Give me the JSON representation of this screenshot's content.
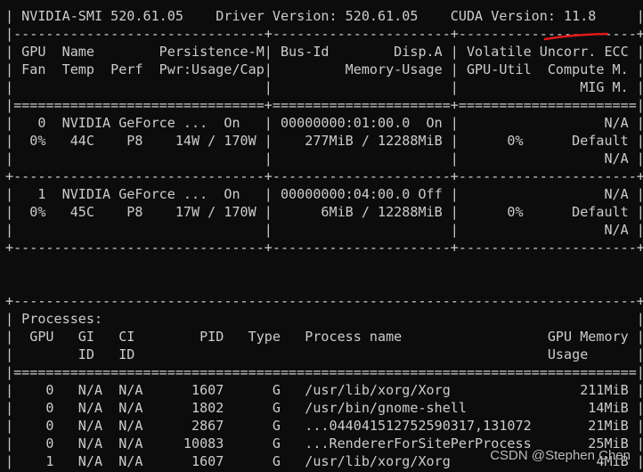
{
  "terminal": {
    "lines": [
      "| NVIDIA-SMI 520.61.05    Driver Version: 520.61.05    CUDA Version: 11.8     |",
      "|-------------------------------+----------------------+----------------------+",
      "| GPU  Name        Persistence-M| Bus-Id        Disp.A | Volatile Uncorr. ECC |",
      "| Fan  Temp  Perf  Pwr:Usage/Cap|         Memory-Usage | GPU-Util  Compute M. |",
      "|                               |                      |               MIG M. |",
      "|===============================+======================+======================|",
      "|   0  NVIDIA GeForce ...  On   | 00000000:01:00.0  On |                  N/A |",
      "|  0%   44C    P8    14W / 170W |    277MiB / 12288MiB |      0%      Default |",
      "|                               |                      |                  N/A |",
      "+-------------------------------+----------------------+----------------------+",
      "|   1  NVIDIA GeForce ...  On   | 00000000:04:00.0 Off |                  N/A |",
      "|  0%   45C    P8    17W / 170W |      6MiB / 12288MiB |      0%      Default |",
      "|                               |                      |                  N/A |",
      "+-------------------------------+----------------------+----------------------+",
      "",
      "",
      "+-----------------------------------------------------------------------------+",
      "| Processes:                                                                  |",
      "|  GPU   GI   CI        PID   Type   Process name                  GPU Memory |",
      "|        ID   ID                                                   Usage      |",
      "|=============================================================================|",
      "|    0   N/A  N/A      1607      G   /usr/lib/xorg/Xorg                211MiB |",
      "|    0   N/A  N/A      1802      G   /usr/bin/gnome-shell               14MiB |",
      "|    0   N/A  N/A      2867      G   ...044041512752590317,131072       21MiB |",
      "|    0   N/A  N/A     10083      G   ...RendererForSitePerProcess       25MiB |",
      "|    1   N/A  N/A      1607      G   /usr/lib/xorg/Xorg                  4MiB |"
    ]
  },
  "watermark": "CSDN @Stephen Chen",
  "colors": {
    "background": "#0c0c0c",
    "text": "#cccccc",
    "underline": "#e0191b"
  }
}
